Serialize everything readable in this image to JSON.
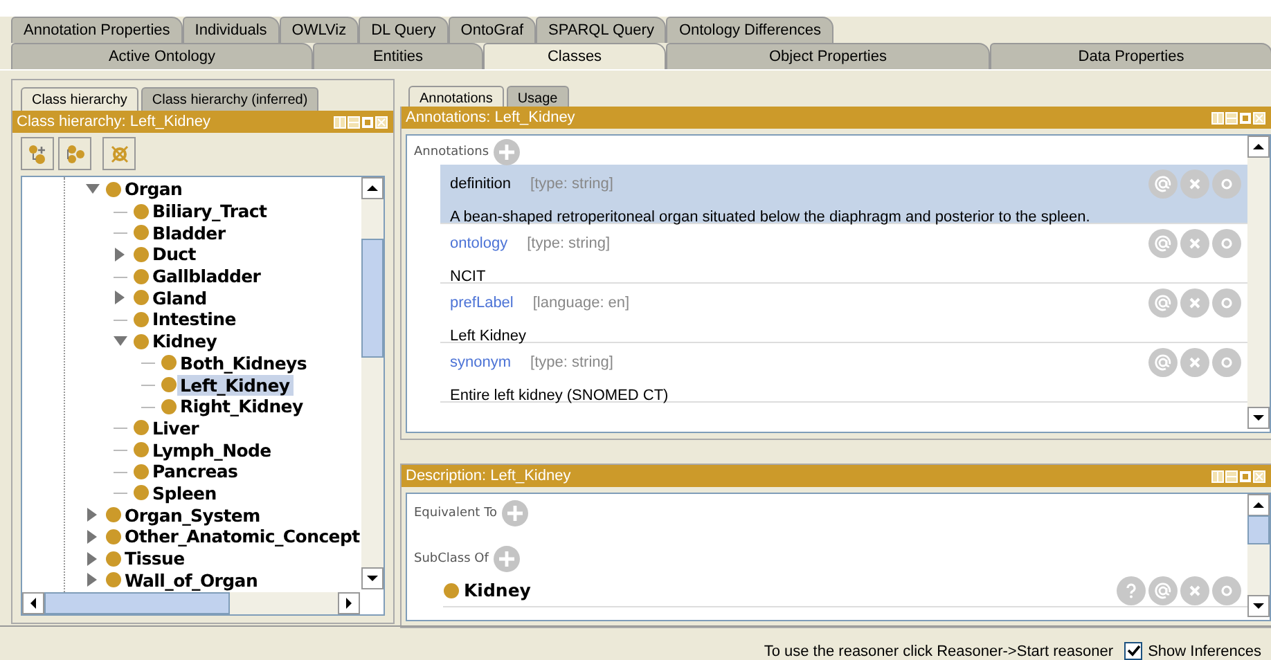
{
  "tabs_row_1": [
    {
      "label": "Annotation Properties",
      "selected": false
    },
    {
      "label": "Individuals",
      "selected": false
    },
    {
      "label": "OWLViz",
      "selected": false
    },
    {
      "label": "DL Query",
      "selected": false
    },
    {
      "label": "OntoGraf",
      "selected": false
    },
    {
      "label": "SPARQL Query",
      "selected": false
    },
    {
      "label": "Ontology Differences",
      "selected": false
    }
  ],
  "tabs_row_2": [
    {
      "label": "Active Ontology",
      "selected": false
    },
    {
      "label": "Entities",
      "selected": false
    },
    {
      "label": "Classes",
      "selected": true
    },
    {
      "label": "Object Properties",
      "selected": false
    },
    {
      "label": "Data Properties",
      "selected": false
    }
  ],
  "left_panel": {
    "tabs": [
      {
        "label": "Class hierarchy",
        "selected": true
      },
      {
        "label": "Class hierarchy (inferred)",
        "selected": false
      }
    ],
    "header": "Class hierarchy: Left_Kidney",
    "tree": [
      {
        "label": "Organ",
        "expanded": true,
        "selected": false,
        "children": [
          {
            "label": "Biliary_Tract",
            "selected": false
          },
          {
            "label": "Bladder",
            "selected": false
          },
          {
            "label": "Duct",
            "expanded": false,
            "selected": false
          },
          {
            "label": "Gallbladder",
            "selected": false
          },
          {
            "label": "Gland",
            "expanded": false,
            "selected": false
          },
          {
            "label": "Intestine",
            "selected": false
          },
          {
            "label": "Kidney",
            "expanded": true,
            "selected": false,
            "children": [
              {
                "label": "Both_Kidneys",
                "selected": false
              },
              {
                "label": "Left_Kidney",
                "selected": true
              },
              {
                "label": "Right_Kidney",
                "selected": false
              }
            ]
          },
          {
            "label": "Liver",
            "selected": false
          },
          {
            "label": "Lymph_Node",
            "selected": false
          },
          {
            "label": "Pancreas",
            "selected": false
          },
          {
            "label": "Spleen",
            "selected": false
          }
        ]
      },
      {
        "label": "Organ_System",
        "expanded": false,
        "selected": false
      },
      {
        "label": "Other_Anatomic_Concept",
        "expanded": false,
        "selected": false
      },
      {
        "label": "Tissue",
        "expanded": false,
        "selected": false
      },
      {
        "label": "Wall_of_Organ",
        "expanded": false,
        "selected": false
      }
    ]
  },
  "right_panel": {
    "tabs": [
      {
        "label": "Annotations",
        "selected": true
      },
      {
        "label": "Usage",
        "selected": false
      }
    ],
    "header": "Annotations: Left_Kidney",
    "section": "Annotations",
    "annotations": [
      {
        "property": "definition",
        "type": "[type: string]",
        "value": "A bean-shaped retroperitoneal organ situated below the diaphragm and posterior to the spleen.",
        "selected": true
      },
      {
        "property": "ontology",
        "type": "[type: string]",
        "value": "NCIT",
        "selected": false
      },
      {
        "property": "prefLabel",
        "type": "[language: en]",
        "value": "Left Kidney",
        "selected": false
      },
      {
        "property": "synonym",
        "type": "[type: string]",
        "value": "Entire left kidney (SNOMED CT)",
        "selected": false
      }
    ]
  },
  "description": {
    "header": "Description: Left_Kidney",
    "sections": [
      {
        "label": "Equivalent To"
      },
      {
        "label": "SubClass Of",
        "items": [
          "Kidney"
        ]
      }
    ]
  },
  "status_bar": {
    "message": "To use the reasoner click Reasoner->Start reasoner",
    "show_inferences": {
      "label": "Show Inferences",
      "checked": true
    }
  }
}
